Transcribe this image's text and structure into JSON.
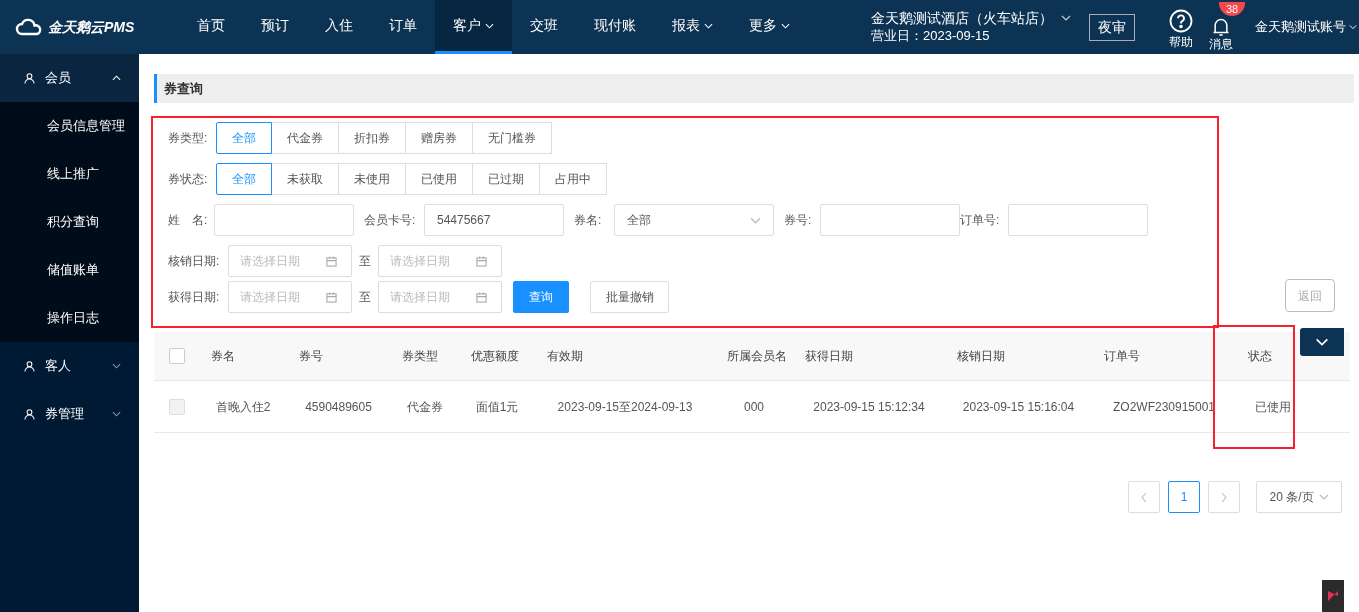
{
  "header": {
    "logo": "金天鹅云PMS",
    "nav": [
      {
        "label": "首页",
        "selected": false,
        "dropdown": false
      },
      {
        "label": "预订",
        "selected": false,
        "dropdown": false
      },
      {
        "label": "入住",
        "selected": false,
        "dropdown": false
      },
      {
        "label": "订单",
        "selected": false,
        "dropdown": false
      },
      {
        "label": "客户",
        "selected": true,
        "dropdown": true
      },
      {
        "label": "交班",
        "selected": false,
        "dropdown": false
      },
      {
        "label": "现付账",
        "selected": false,
        "dropdown": false
      },
      {
        "label": "报表",
        "selected": false,
        "dropdown": true
      },
      {
        "label": "更多",
        "selected": false,
        "dropdown": true
      }
    ],
    "hotel": "金天鹅测试酒店（火车站店）",
    "business_date": "营业日：2023-09-15",
    "night_audit": "夜审",
    "help": "帮助",
    "messages": "消息",
    "message_count": "38",
    "account": "金天鹅测试账号"
  },
  "sidebar": {
    "items": [
      {
        "label": "会员",
        "expanded": true,
        "selected": true,
        "children": [
          {
            "label": "会员信息管理",
            "selected": false
          },
          {
            "label": "线上推广",
            "selected": false
          },
          {
            "label": "积分查询",
            "selected": false
          },
          {
            "label": "储值账单",
            "selected": false
          },
          {
            "label": "操作日志",
            "selected": false
          }
        ]
      },
      {
        "label": "客人",
        "expanded": false,
        "selected": false
      },
      {
        "label": "券管理",
        "expanded": false,
        "selected": false
      }
    ]
  },
  "page_title": "券查询",
  "filters": {
    "type_label": "券类型:",
    "types": [
      {
        "label": "全部",
        "selected": true
      },
      {
        "label": "代金券",
        "selected": false
      },
      {
        "label": "折扣券",
        "selected": false
      },
      {
        "label": "赠房券",
        "selected": false
      },
      {
        "label": "无门槛券",
        "selected": false
      }
    ],
    "status_label": "券状态:",
    "statuses": [
      {
        "label": "全部",
        "selected": true
      },
      {
        "label": "未获取",
        "selected": false
      },
      {
        "label": "未使用",
        "selected": false
      },
      {
        "label": "已使用",
        "selected": false
      },
      {
        "label": "已过期",
        "selected": false
      },
      {
        "label": "占用中",
        "selected": false
      }
    ],
    "name_label": "姓　名:",
    "card_label": "会员卡号:",
    "card_value": "54475667",
    "coupon_name_label": "券名:",
    "coupon_name_value": "全部",
    "coupon_no_label": "券号:",
    "order_no_label": "订单号:",
    "date_ranges": [
      {
        "label": "核销日期:",
        "from_placeholder": "请选择日期",
        "to": "至",
        "to_placeholder": "请选择日期"
      },
      {
        "label": "获得日期:",
        "from_placeholder": "请选择日期",
        "to": "至",
        "to_placeholder": "请选择日期"
      }
    ],
    "search_button": "查询",
    "batch_button": "批量撤销",
    "back_button": "返回"
  },
  "table": {
    "all_selected": false,
    "columns": [
      "券名",
      "券号",
      "券类型",
      "优惠额度",
      "有效期",
      "所属会员名",
      "获得日期",
      "核销日期",
      "订单号",
      "状态"
    ],
    "rows": [
      {
        "selected": false,
        "cells": [
          "首晚入住2",
          "4590489605",
          "代金券",
          "面值1元",
          "2023-09-15至2024-09-13",
          "000",
          "2023-09-15 15:12:34",
          "2023-09-15 15:16:04",
          "ZO2WF230915001",
          "已使用"
        ]
      }
    ]
  },
  "pagination": {
    "pages": [
      {
        "label": "1",
        "selected": true
      }
    ],
    "page_size": "20 条/页"
  }
}
